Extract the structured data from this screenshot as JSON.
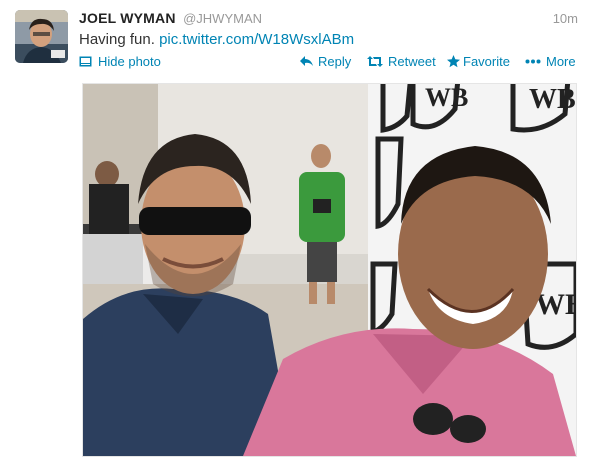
{
  "tweet": {
    "fullname": "JOEL WYMAN",
    "username": "@JHWYMAN",
    "time": "10m",
    "text": "Having fun.",
    "link": "pic.twitter.com/W18WsxlABm"
  },
  "actions": {
    "hide_photo": "Hide photo",
    "reply": "Reply",
    "retweet": "Retweet",
    "favorite": "Favorite",
    "more": "More"
  },
  "colors": {
    "link": "#0084b4",
    "muted": "#999999",
    "name": "#222222"
  },
  "icons": [
    "photo-icon",
    "reply-arrow-icon",
    "retweet-icon",
    "star-icon",
    "dots-icon"
  ]
}
